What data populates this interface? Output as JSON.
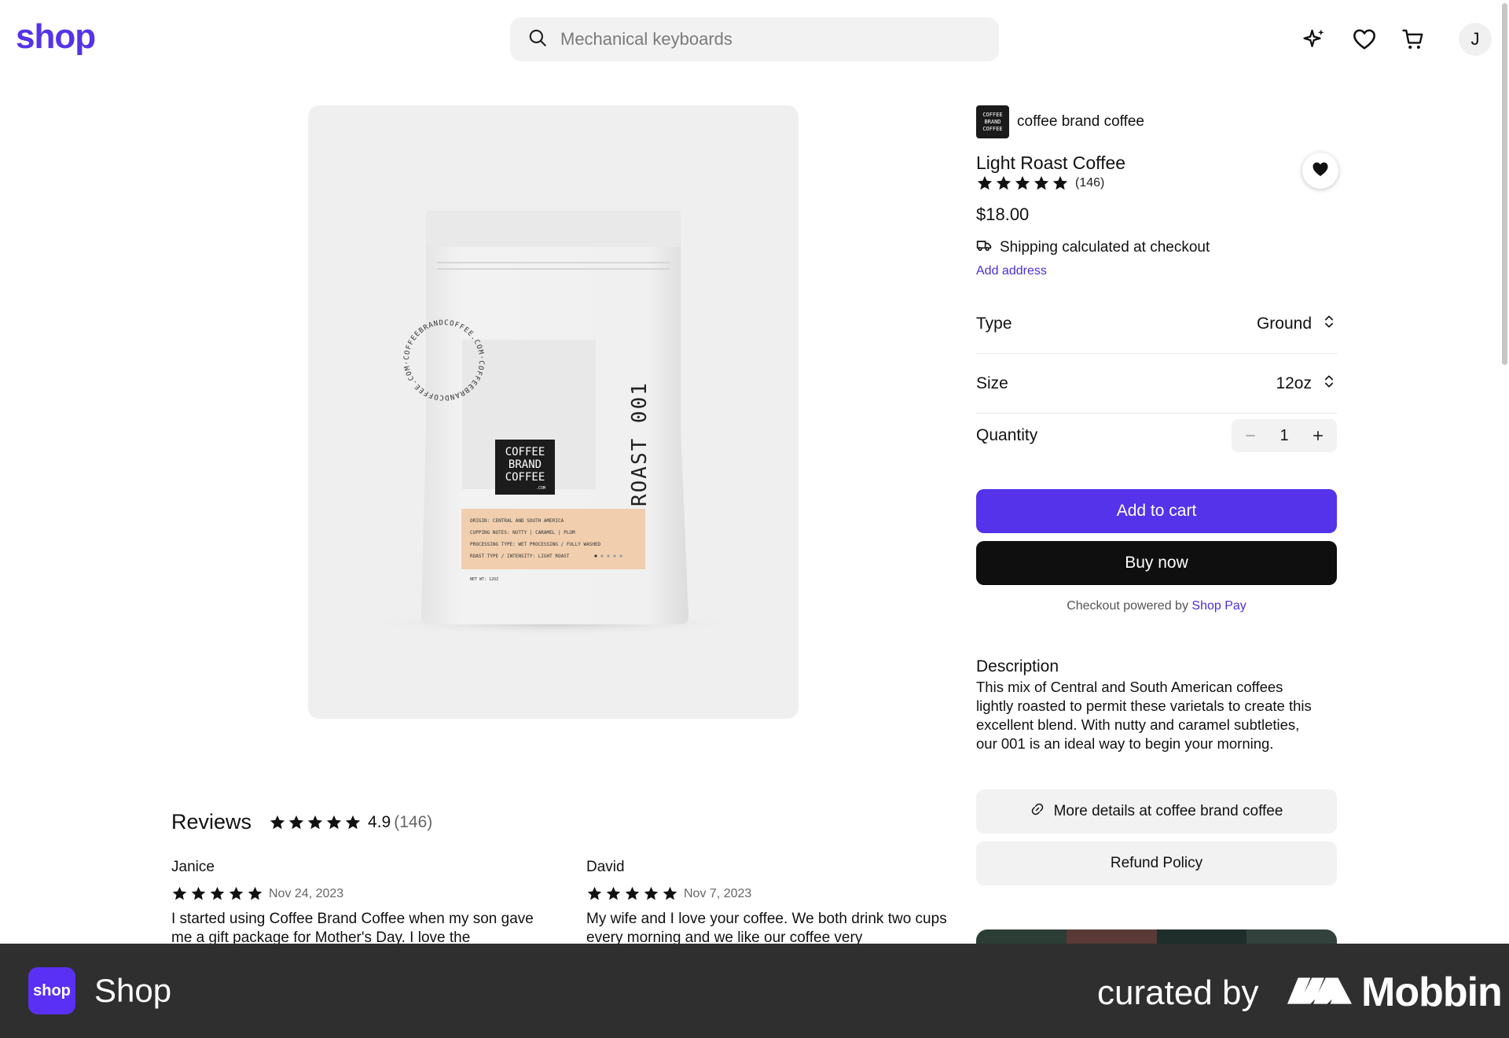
{
  "header": {
    "logo": "shop",
    "search_placeholder": "Mechanical keyboards",
    "avatar_initial": "J",
    "icons": [
      "sparkle-icon",
      "heart-icon",
      "cart-icon"
    ]
  },
  "product": {
    "brand_name": "coffee brand coffee",
    "brand_logo_text": "COFFEE BRAND COFFEE",
    "title": "Light Roast Coffee",
    "rating_count": "(146)",
    "stars": 5,
    "price": "$18.00",
    "shipping": "Shipping calculated at checkout",
    "add_address": "Add address",
    "bag": {
      "brand": "COFFEE BRAND COFFEE",
      "brand_sub": ".COM",
      "roast": "ROAST 001",
      "circle_text": "COFFEEBRANDCOFFEE.COM·COFFEEBRANDCOFFEE.COM·",
      "label_lines": [
        "ORIGIN: CENTRAL AND SOUTH AMERICA",
        "CUPPING NOTES: NUTTY | CARAMEL | PLUM",
        "PROCESSING TYPE: WET PROCESSING / FULLY WASHED",
        "ROAST TYPE / INTENSITY: LIGHT ROAST"
      ],
      "net_wt": "NET WT: 12OZ"
    }
  },
  "options": {
    "type_label": "Type",
    "type_value": "Ground",
    "size_label": "Size",
    "size_value": "12oz",
    "quantity_label": "Quantity",
    "quantity_value": "1"
  },
  "actions": {
    "add_to_cart": "Add to cart",
    "buy_now": "Buy now",
    "checkout_prefix": "Checkout powered by",
    "checkout_brand": "Shop Pay"
  },
  "description": {
    "title": "Description",
    "body": "This mix of Central and South American coffees lightly roasted to permit these varietals to create this excellent blend. With nutty and caramel subtleties, our 001 is an ideal way to begin your morning.",
    "more_details": "More details at coffee brand coffee",
    "refund_policy": "Refund Policy"
  },
  "reviews": {
    "title": "Reviews",
    "average": "4.9",
    "count": "(146)",
    "items": [
      {
        "name": "Janice",
        "date": "Nov 24, 2023",
        "text": "I started using Coffee Brand Coffee when my son gave me a gift package for Mother's Day. I love the"
      },
      {
        "name": "David",
        "date": "Nov 7, 2023",
        "text": "My wife and I love your coffee. We both drink two cups every morning and we like our coffee very"
      }
    ]
  },
  "footer": {
    "app_icon_text": "shop",
    "app_name": "Shop",
    "curated_by": "curated by",
    "brand": "Mobbin"
  },
  "colors": {
    "accent": "#5433eb",
    "buy_now": "#0f0f0f",
    "footer_bg": "#2f2f2f",
    "label_peach": "#f1cfae"
  }
}
